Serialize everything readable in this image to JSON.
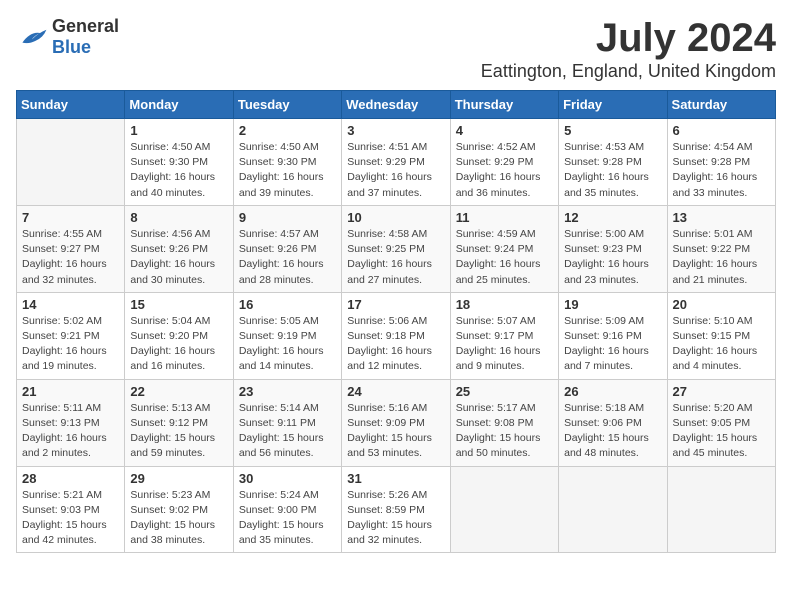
{
  "logo": {
    "general": "General",
    "blue": "Blue"
  },
  "title": "July 2024",
  "location": "Eattington, England, United Kingdom",
  "headers": [
    "Sunday",
    "Monday",
    "Tuesday",
    "Wednesday",
    "Thursday",
    "Friday",
    "Saturday"
  ],
  "weeks": [
    [
      {
        "day": "",
        "info": ""
      },
      {
        "day": "1",
        "info": "Sunrise: 4:50 AM\nSunset: 9:30 PM\nDaylight: 16 hours\nand 40 minutes."
      },
      {
        "day": "2",
        "info": "Sunrise: 4:50 AM\nSunset: 9:30 PM\nDaylight: 16 hours\nand 39 minutes."
      },
      {
        "day": "3",
        "info": "Sunrise: 4:51 AM\nSunset: 9:29 PM\nDaylight: 16 hours\nand 37 minutes."
      },
      {
        "day": "4",
        "info": "Sunrise: 4:52 AM\nSunset: 9:29 PM\nDaylight: 16 hours\nand 36 minutes."
      },
      {
        "day": "5",
        "info": "Sunrise: 4:53 AM\nSunset: 9:28 PM\nDaylight: 16 hours\nand 35 minutes."
      },
      {
        "day": "6",
        "info": "Sunrise: 4:54 AM\nSunset: 9:28 PM\nDaylight: 16 hours\nand 33 minutes."
      }
    ],
    [
      {
        "day": "7",
        "info": "Sunrise: 4:55 AM\nSunset: 9:27 PM\nDaylight: 16 hours\nand 32 minutes."
      },
      {
        "day": "8",
        "info": "Sunrise: 4:56 AM\nSunset: 9:26 PM\nDaylight: 16 hours\nand 30 minutes."
      },
      {
        "day": "9",
        "info": "Sunrise: 4:57 AM\nSunset: 9:26 PM\nDaylight: 16 hours\nand 28 minutes."
      },
      {
        "day": "10",
        "info": "Sunrise: 4:58 AM\nSunset: 9:25 PM\nDaylight: 16 hours\nand 27 minutes."
      },
      {
        "day": "11",
        "info": "Sunrise: 4:59 AM\nSunset: 9:24 PM\nDaylight: 16 hours\nand 25 minutes."
      },
      {
        "day": "12",
        "info": "Sunrise: 5:00 AM\nSunset: 9:23 PM\nDaylight: 16 hours\nand 23 minutes."
      },
      {
        "day": "13",
        "info": "Sunrise: 5:01 AM\nSunset: 9:22 PM\nDaylight: 16 hours\nand 21 minutes."
      }
    ],
    [
      {
        "day": "14",
        "info": "Sunrise: 5:02 AM\nSunset: 9:21 PM\nDaylight: 16 hours\nand 19 minutes."
      },
      {
        "day": "15",
        "info": "Sunrise: 5:04 AM\nSunset: 9:20 PM\nDaylight: 16 hours\nand 16 minutes."
      },
      {
        "day": "16",
        "info": "Sunrise: 5:05 AM\nSunset: 9:19 PM\nDaylight: 16 hours\nand 14 minutes."
      },
      {
        "day": "17",
        "info": "Sunrise: 5:06 AM\nSunset: 9:18 PM\nDaylight: 16 hours\nand 12 minutes."
      },
      {
        "day": "18",
        "info": "Sunrise: 5:07 AM\nSunset: 9:17 PM\nDaylight: 16 hours\nand 9 minutes."
      },
      {
        "day": "19",
        "info": "Sunrise: 5:09 AM\nSunset: 9:16 PM\nDaylight: 16 hours\nand 7 minutes."
      },
      {
        "day": "20",
        "info": "Sunrise: 5:10 AM\nSunset: 9:15 PM\nDaylight: 16 hours\nand 4 minutes."
      }
    ],
    [
      {
        "day": "21",
        "info": "Sunrise: 5:11 AM\nSunset: 9:13 PM\nDaylight: 16 hours\nand 2 minutes."
      },
      {
        "day": "22",
        "info": "Sunrise: 5:13 AM\nSunset: 9:12 PM\nDaylight: 15 hours\nand 59 minutes."
      },
      {
        "day": "23",
        "info": "Sunrise: 5:14 AM\nSunset: 9:11 PM\nDaylight: 15 hours\nand 56 minutes."
      },
      {
        "day": "24",
        "info": "Sunrise: 5:16 AM\nSunset: 9:09 PM\nDaylight: 15 hours\nand 53 minutes."
      },
      {
        "day": "25",
        "info": "Sunrise: 5:17 AM\nSunset: 9:08 PM\nDaylight: 15 hours\nand 50 minutes."
      },
      {
        "day": "26",
        "info": "Sunrise: 5:18 AM\nSunset: 9:06 PM\nDaylight: 15 hours\nand 48 minutes."
      },
      {
        "day": "27",
        "info": "Sunrise: 5:20 AM\nSunset: 9:05 PM\nDaylight: 15 hours\nand 45 minutes."
      }
    ],
    [
      {
        "day": "28",
        "info": "Sunrise: 5:21 AM\nSunset: 9:03 PM\nDaylight: 15 hours\nand 42 minutes."
      },
      {
        "day": "29",
        "info": "Sunrise: 5:23 AM\nSunset: 9:02 PM\nDaylight: 15 hours\nand 38 minutes."
      },
      {
        "day": "30",
        "info": "Sunrise: 5:24 AM\nSunset: 9:00 PM\nDaylight: 15 hours\nand 35 minutes."
      },
      {
        "day": "31",
        "info": "Sunrise: 5:26 AM\nSunset: 8:59 PM\nDaylight: 15 hours\nand 32 minutes."
      },
      {
        "day": "",
        "info": ""
      },
      {
        "day": "",
        "info": ""
      },
      {
        "day": "",
        "info": ""
      }
    ]
  ]
}
